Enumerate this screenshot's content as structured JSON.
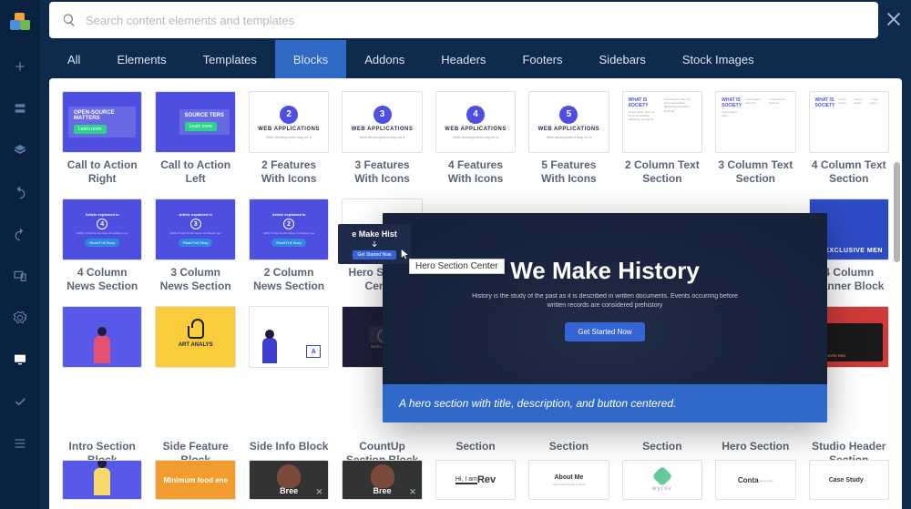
{
  "search": {
    "placeholder": "Search content elements and templates"
  },
  "tabs": [
    "All",
    "Elements",
    "Templates",
    "Blocks",
    "Addons",
    "Headers",
    "Footers",
    "Sidebars",
    "Stock Images"
  ],
  "active_tab": "Blocks",
  "row1": [
    {
      "label": "Call to Action Right",
      "cta": "OPEN-SOURCE MATTERS"
    },
    {
      "label": "Call to Action Left",
      "cta": "SOURCE TERS"
    },
    {
      "label": "2 Features With Icons",
      "num": "2",
      "t": "WEB APPLICATIONS",
      "d": "Web development may be a"
    },
    {
      "label": "3 Features With Icons",
      "num": "3",
      "t": "WEB APPLICATIONS",
      "d": "Web development may be a"
    },
    {
      "label": "4 Features With Icons",
      "num": "4",
      "t": "WEB APPLICATIONS",
      "d": "Web development may be a"
    },
    {
      "label": "5 Features With Icons",
      "num": "5",
      "t": "WEB APPLICATIONS",
      "d": "Web development may be a"
    },
    {
      "label": "2 Column Text Section",
      "h": "WHAT IS SOCIETY"
    },
    {
      "label": "3 Column Text Section",
      "h": "WHAT IS SOCIETY"
    },
    {
      "label": "4 Column Text Section",
      "h": "WHAT IS SOCIETY"
    }
  ],
  "row2": {
    "news": [
      {
        "label": "4 Column News Section",
        "n": "4",
        "t": "Article explained in",
        "btn": "Read Full Story"
      },
      {
        "label": "3 Column News Section",
        "n": "3",
        "t": "Article explained in",
        "btn": "Read Full Story"
      },
      {
        "label": "2 Column News Section",
        "n": "2",
        "t": "Article explained in",
        "btn": "Read Full Story"
      }
    ],
    "hero": {
      "label": "Hero Section Center",
      "t": "e Make Hist"
    },
    "excl": {
      "label": "4 Column Banner Block",
      "t": "EXCLUSIVE MEN"
    }
  },
  "row3": [
    {
      "label": "Intro Section Block"
    },
    {
      "label": "Side Feature Block",
      "t": "ART ANALYS"
    },
    {
      "label": "Side Info Block",
      "a": "A"
    },
    {
      "label": "CountUp Section Block",
      "t": "MORA CX300"
    },
    {
      "label": "Section"
    },
    {
      "label": "Section"
    },
    {
      "label": "Section"
    },
    {
      "label": "Hero Section"
    },
    {
      "label": "Studio Header Section",
      "t": "LONHORN RED"
    }
  ],
  "row4": [
    {
      "t": ""
    },
    {
      "t": "Minimum food ene"
    },
    {
      "t": "Bree"
    },
    {
      "t": "Bree"
    },
    {
      "t": "Hi, I am",
      "b": "Rev"
    },
    {
      "t": "About Me"
    },
    {
      "t": "wycov"
    },
    {
      "t": "Conta"
    },
    {
      "t": "Case Study"
    }
  ],
  "preview": {
    "title": "We Make History",
    "desc": "History is the study of the past as it is described in written documents. Events occurring before written records are considered prehistory",
    "button": "Get Started Now",
    "caption": "A hero section with title, description, and button centered."
  },
  "tooltip": "Hero Section Center"
}
